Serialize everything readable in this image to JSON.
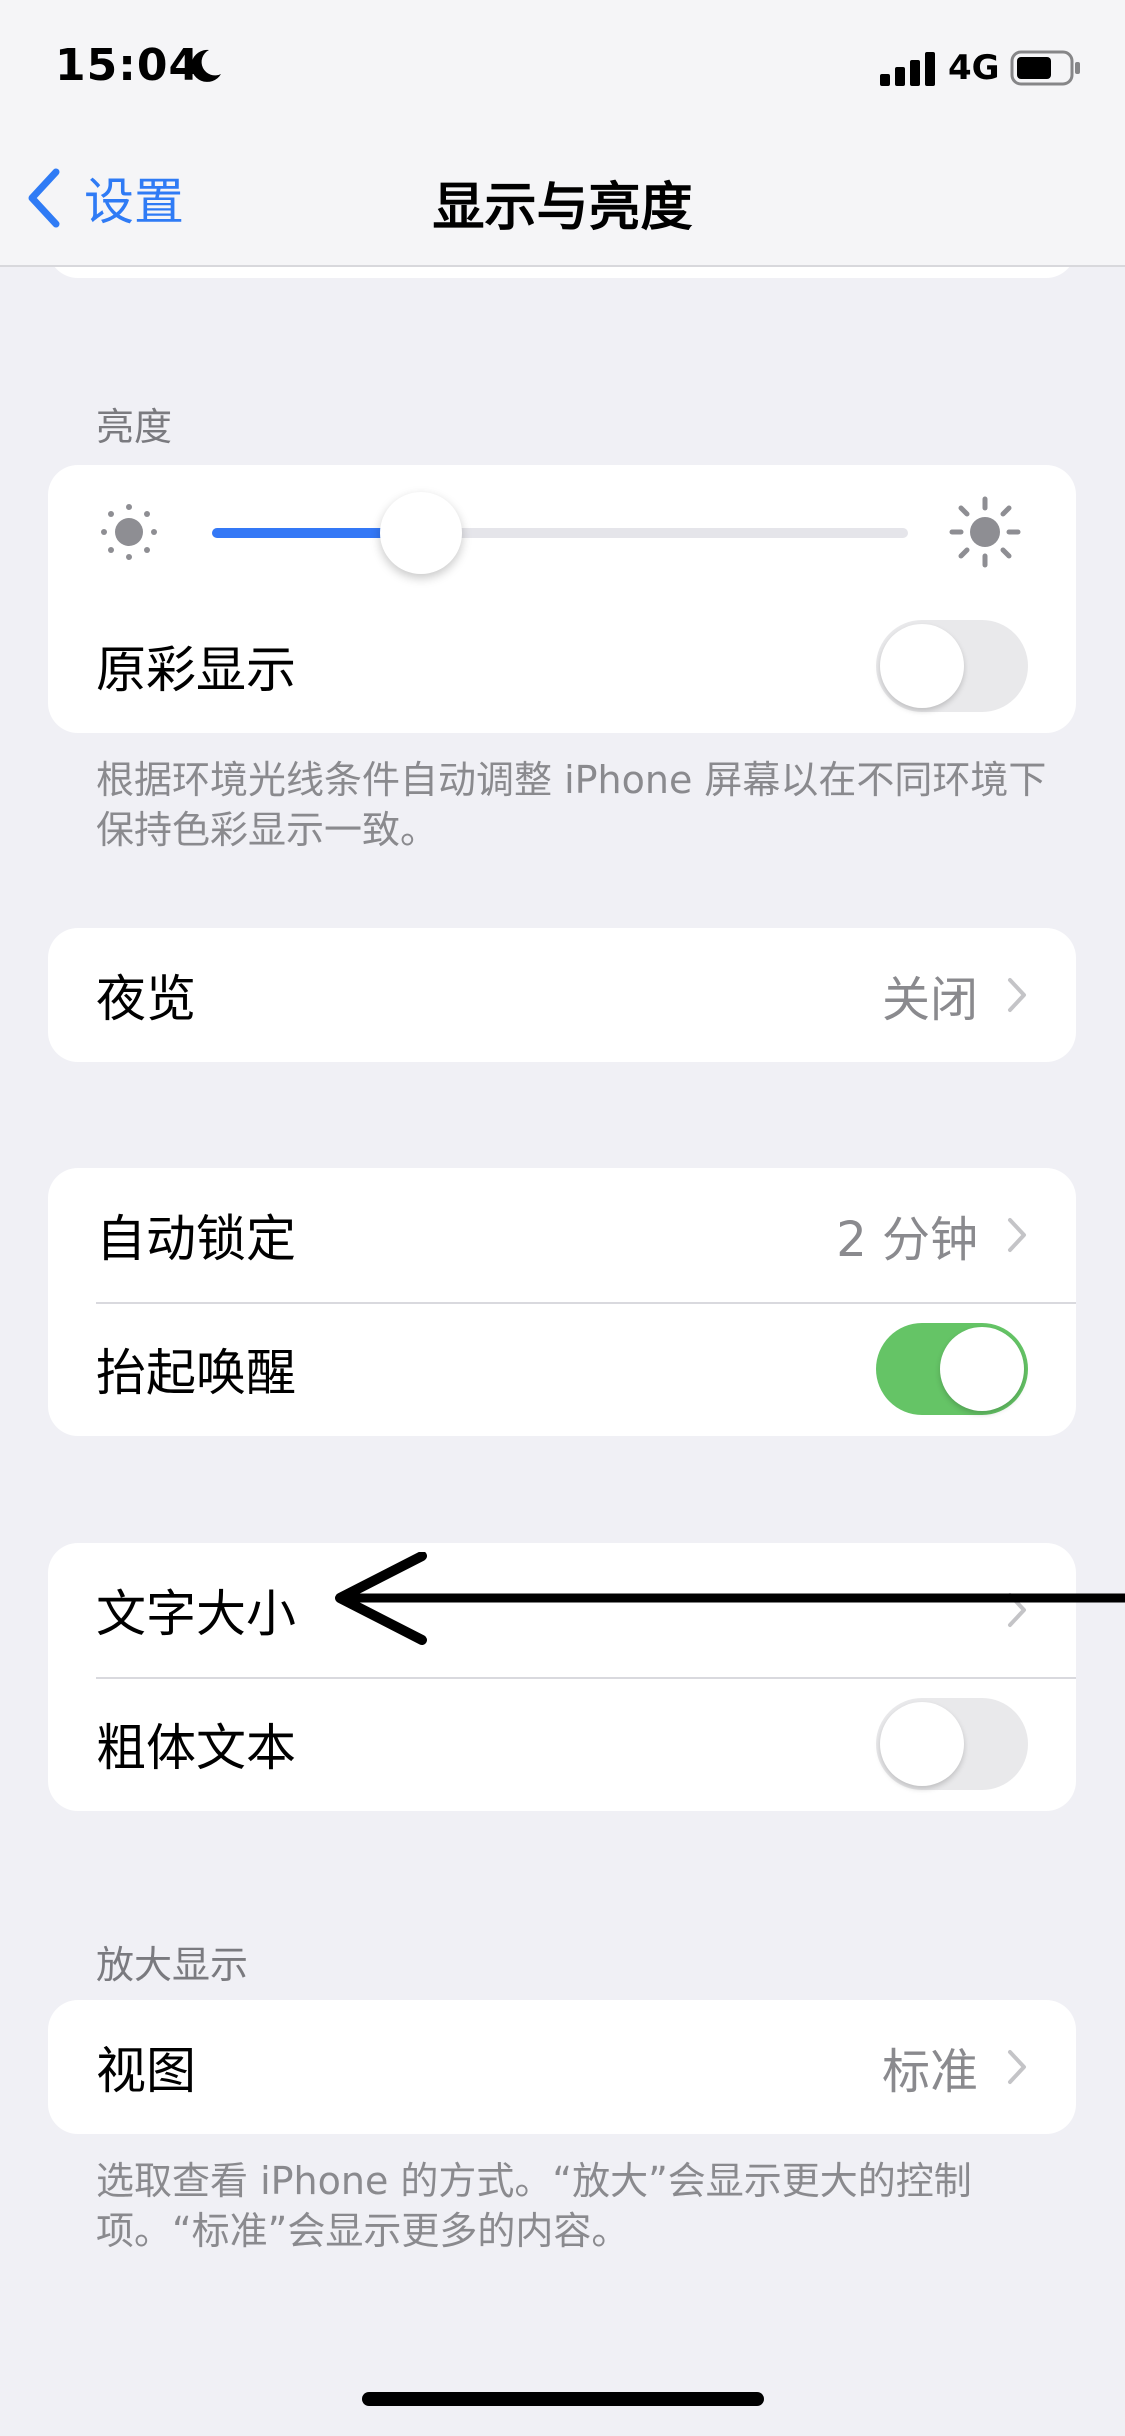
{
  "status_bar": {
    "time": "15:04",
    "network": "4G"
  },
  "nav": {
    "back_label": "设置",
    "title": "显示与亮度"
  },
  "brightness": {
    "header": "亮度",
    "level": 0.3,
    "true_tone_label": "原彩显示",
    "true_tone_on": false,
    "footer": "根据环境光线条件自动调整 iPhone 屏幕以在不同环境下保持色彩显示一致。"
  },
  "night_shift": {
    "label": "夜览",
    "value": "关闭"
  },
  "lock": {
    "auto_lock_label": "自动锁定",
    "auto_lock_value": "2 分钟",
    "raise_to_wake_label": "抬起唤醒",
    "raise_to_wake_on": true
  },
  "text": {
    "text_size_label": "文字大小",
    "bold_text_label": "粗体文本",
    "bold_text_on": false
  },
  "zoom": {
    "header": "放大显示",
    "view_label": "视图",
    "view_value": "标准",
    "footer": "选取查看 iPhone 的方式。“放大”会显示更大的控制项。“标准”会显示更多的内容。"
  },
  "colors": {
    "accent": "#3478f6",
    "toggle_on": "#65c466",
    "background": "#f0f0f5"
  }
}
